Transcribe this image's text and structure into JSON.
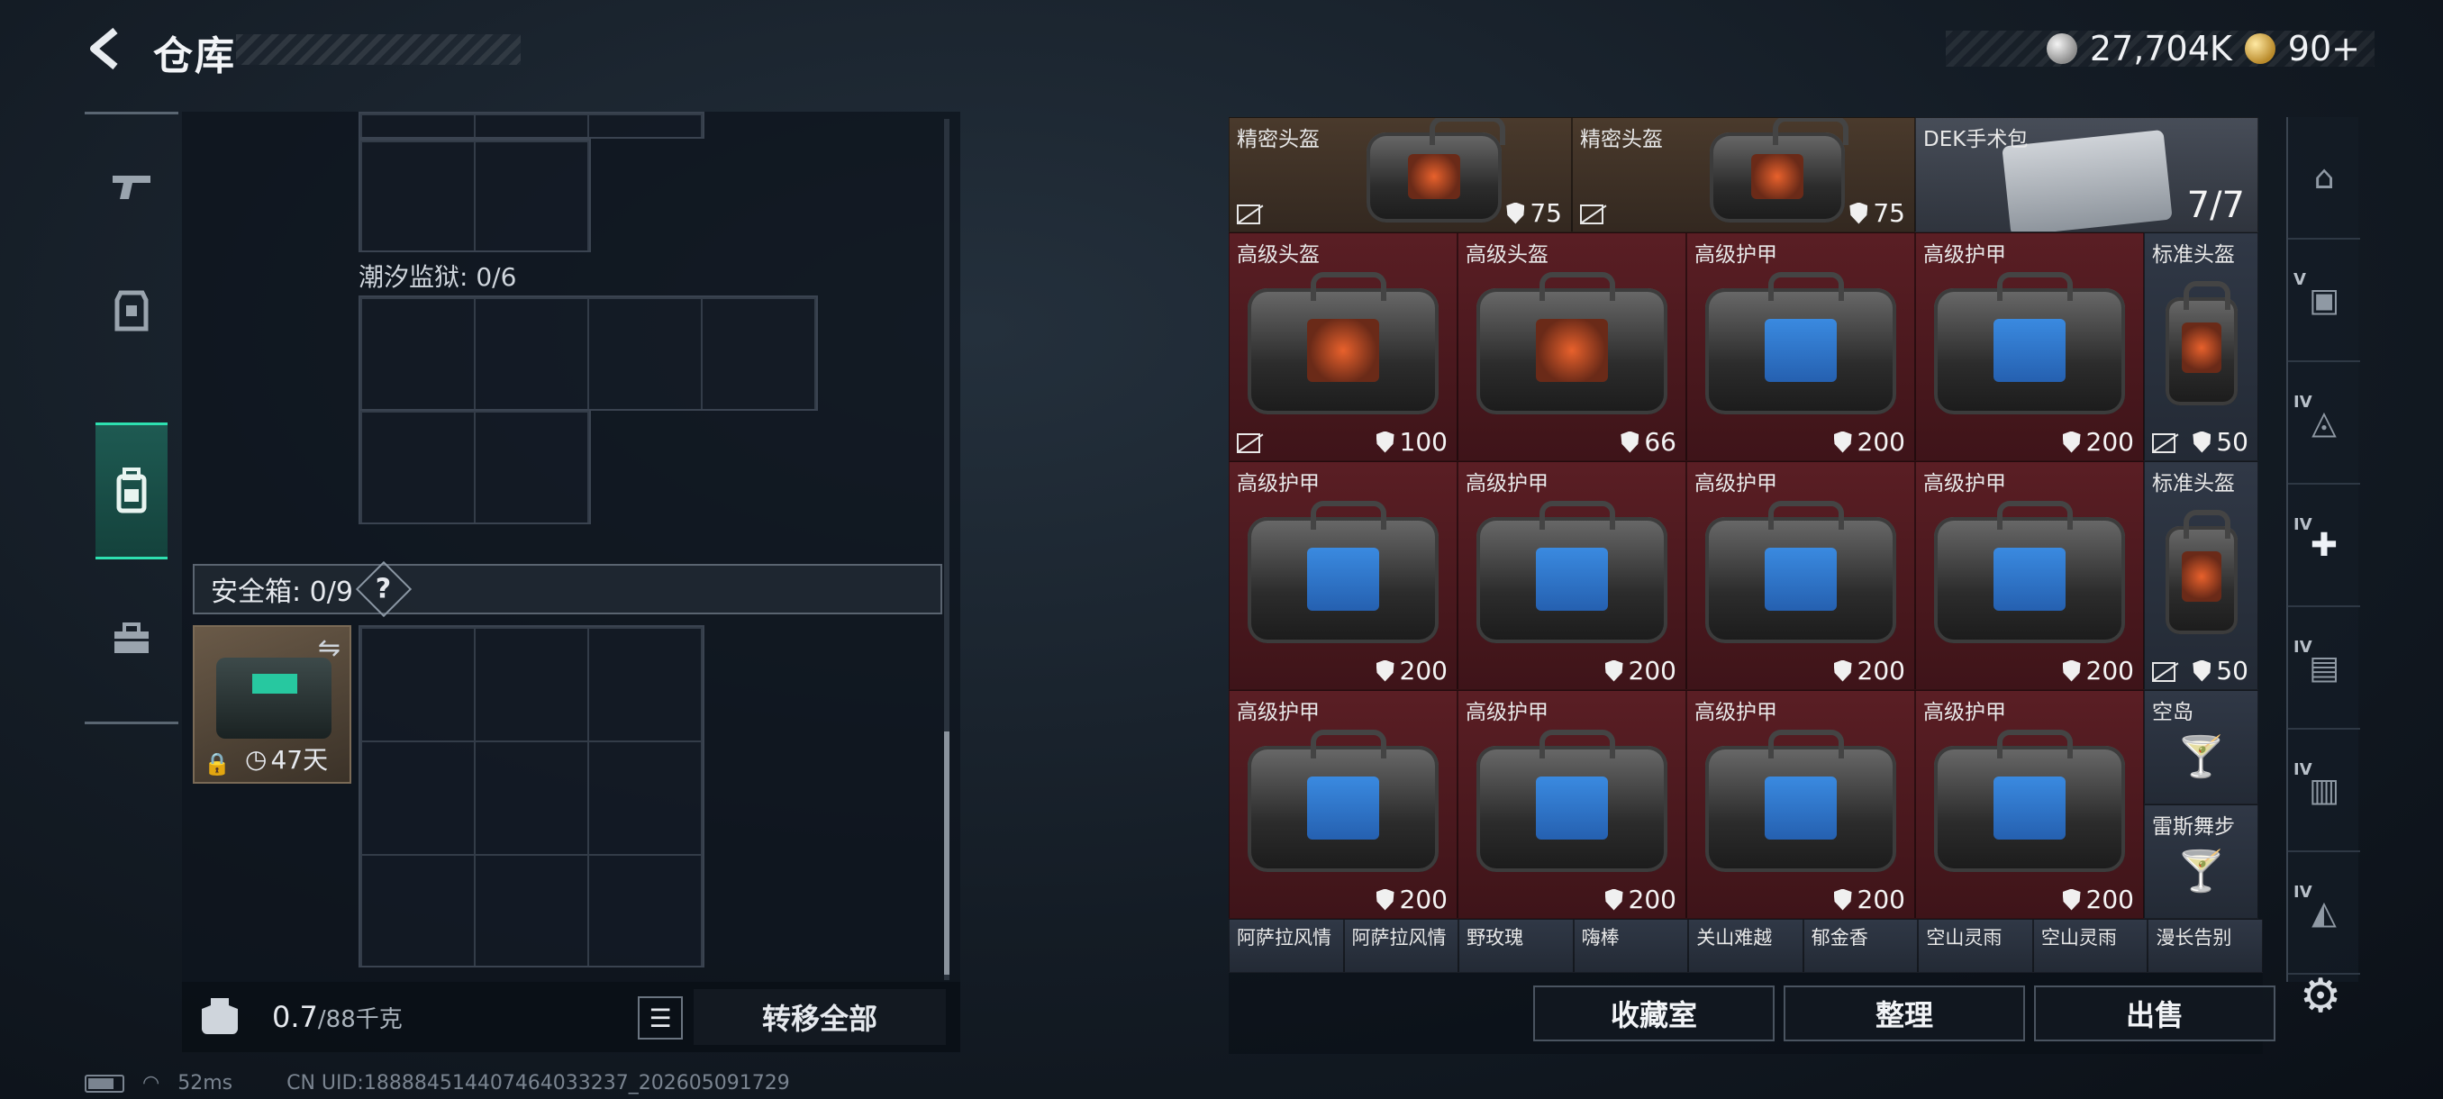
{
  "header": {
    "title": "仓库",
    "currency": [
      {
        "icon": "silver-coin-icon",
        "value": "27,704K"
      },
      {
        "icon": "gold-coin-icon",
        "value": "90+"
      }
    ]
  },
  "left_nav": [
    "pistol-icon",
    "armor-vest-icon",
    "backpack-icon",
    "toolbox-icon"
  ],
  "left_panel": {
    "prison_label": "潮汐监狱: 0/6",
    "safebox_label": "安全箱: 0/9",
    "help": "?",
    "safebox_item_timer": "47天",
    "weight_value": "0.7",
    "weight_max": "/88千克",
    "transfer_all": "转移全部"
  },
  "items": [
    {
      "name": "精密头盔",
      "value": "75",
      "shield": true,
      "noicon": true,
      "bg": "brown",
      "art": "bag-orange-small"
    },
    {
      "name": "精密头盔",
      "value": "75",
      "shield": true,
      "noicon": true,
      "bg": "brown",
      "art": "bag-orange-small"
    },
    {
      "name": "DEK手术包",
      "value": "7/7",
      "bg": "gray",
      "art": "medkit"
    },
    {
      "name": "高级头盔",
      "value": "100",
      "shield": true,
      "noicon": true,
      "bg": "red",
      "art": "bag-orange"
    },
    {
      "name": "高级头盔",
      "value": "66",
      "shield": true,
      "bg": "red",
      "art": "bag-orange"
    },
    {
      "name": "高级护甲",
      "value": "200",
      "shield": true,
      "bg": "red",
      "art": "bag-blue"
    },
    {
      "name": "高级护甲",
      "value": "200",
      "shield": true,
      "bg": "red",
      "art": "bag-blue"
    },
    {
      "name": "标准头盔",
      "value": "50",
      "shield": true,
      "noicon": true,
      "bg": "slate",
      "art": "bag-tall"
    },
    {
      "name": "高级护甲",
      "value": "200",
      "shield": true,
      "bg": "red",
      "art": "bag-blue"
    },
    {
      "name": "高级护甲",
      "value": "200",
      "shield": true,
      "bg": "red",
      "art": "bag-blue"
    },
    {
      "name": "高级护甲",
      "value": "200",
      "shield": true,
      "bg": "red",
      "art": "bag-blue"
    },
    {
      "name": "高级护甲",
      "value": "200",
      "shield": true,
      "bg": "red",
      "art": "bag-blue"
    },
    {
      "name": "标准头盔",
      "value": "50",
      "shield": true,
      "noicon": true,
      "bg": "slate",
      "art": "bag-tall"
    },
    {
      "name": "高级护甲",
      "value": "200",
      "shield": true,
      "bg": "red",
      "art": "bag-blue"
    },
    {
      "name": "高级护甲",
      "value": "200",
      "shield": true,
      "bg": "red",
      "art": "bag-blue"
    },
    {
      "name": "高级护甲",
      "value": "200",
      "shield": true,
      "bg": "red",
      "art": "bag-blue"
    },
    {
      "name": "高级护甲",
      "value": "200",
      "shield": true,
      "bg": "red",
      "art": "bag-blue"
    },
    {
      "name": "空岛",
      "bg": "slate",
      "art": "drink"
    },
    {
      "name": "雷斯舞步",
      "bg": "slate",
      "art": "drink"
    }
  ],
  "bottom_row": [
    "阿萨拉风情",
    "阿萨拉风情",
    "野玫瑰",
    "嗨棒",
    "关山难越",
    "郁金香",
    "空山灵雨",
    "空山灵雨",
    "漫长告别"
  ],
  "actions": {
    "collection": "收藏室",
    "sort": "整理",
    "sell": "出售"
  },
  "right_nav": [
    {
      "icon": "helmet-icon",
      "tier": ""
    },
    {
      "icon": "camera-icon",
      "tier": "V"
    },
    {
      "icon": "weapon-crate-icon",
      "tier": "IV"
    },
    {
      "icon": "medical-kit-icon",
      "tier": "IV"
    },
    {
      "icon": "ammo-box-icon",
      "tier": "IV"
    },
    {
      "icon": "folder-icon",
      "tier": "IV"
    },
    {
      "icon": "map-icon",
      "tier": "IV"
    }
  ],
  "status": {
    "ping": "52ms",
    "uid": "CN UID:1888845144074640332​37_202605091729"
  },
  "colors": {
    "accent": "#2ee0b0",
    "red_rarity": "#5a1e24",
    "brown_rarity": "#4a3a2c"
  }
}
